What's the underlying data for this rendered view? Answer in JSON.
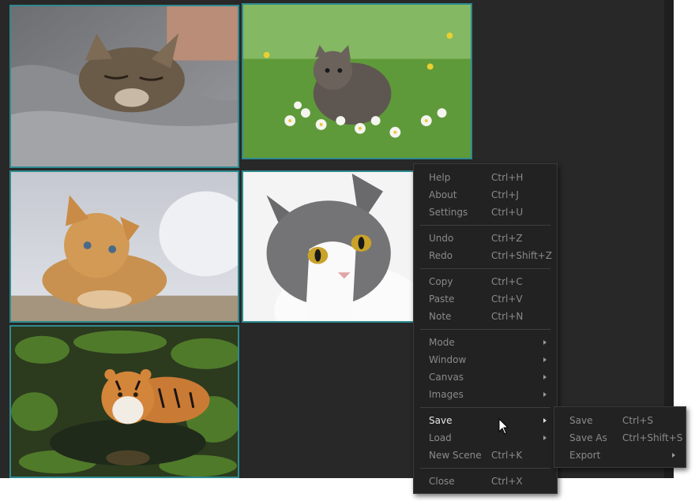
{
  "images": [
    {
      "subject": "sleeping tabby kitten on grey blanket"
    },
    {
      "subject": "tabby kitten in grass with daisies"
    },
    {
      "subject": "orange kitten lying down"
    },
    {
      "subject": "grey and white cat portrait"
    },
    {
      "subject": "tiger swimming in green water"
    }
  ],
  "context_menu": {
    "groups": [
      [
        {
          "label": "Help",
          "shortcut": "Ctrl+H"
        },
        {
          "label": "About",
          "shortcut": "Ctrl+J"
        },
        {
          "label": "Settings",
          "shortcut": "Ctrl+U"
        }
      ],
      [
        {
          "label": "Undo",
          "shortcut": "Ctrl+Z"
        },
        {
          "label": "Redo",
          "shortcut": "Ctrl+Shift+Z"
        }
      ],
      [
        {
          "label": "Copy",
          "shortcut": "Ctrl+C"
        },
        {
          "label": "Paste",
          "shortcut": "Ctrl+V"
        },
        {
          "label": "Note",
          "shortcut": "Ctrl+N"
        }
      ],
      [
        {
          "label": "Mode",
          "submenu": true
        },
        {
          "label": "Window",
          "submenu": true
        },
        {
          "label": "Canvas",
          "submenu": true
        },
        {
          "label": "Images",
          "submenu": true
        }
      ],
      [
        {
          "label": "Save",
          "submenu": true,
          "active": true
        },
        {
          "label": "Load",
          "submenu": true
        },
        {
          "label": "New Scene",
          "shortcut": "Ctrl+K"
        }
      ],
      [
        {
          "label": "Close",
          "shortcut": "Ctrl+X"
        }
      ]
    ]
  },
  "save_submenu": {
    "items": [
      {
        "label": "Save",
        "shortcut": "Ctrl+S"
      },
      {
        "label": "Save As",
        "shortcut": "Ctrl+Shift+S"
      },
      {
        "label": "Export",
        "submenu": true
      }
    ]
  },
  "colors": {
    "canvas_bg": "#282828",
    "thumb_border": "#2e8a8f",
    "menu_bg": "#222222",
    "menu_text": "#8a8a8a",
    "menu_text_active": "#e6e6e6"
  },
  "cursor": {
    "icon": "arrow-cursor-icon"
  }
}
